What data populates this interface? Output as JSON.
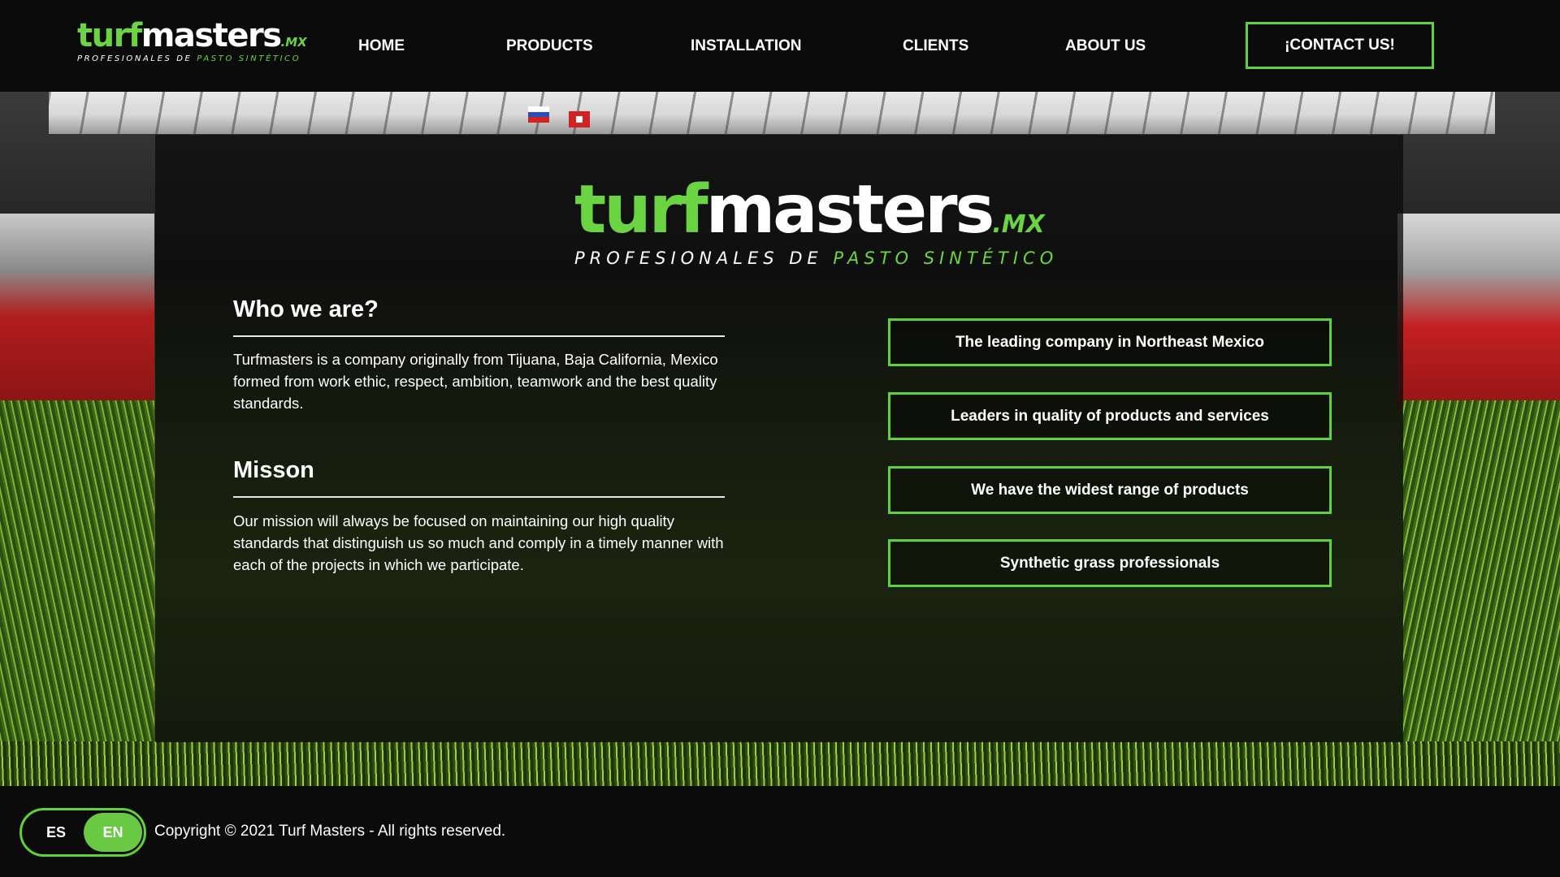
{
  "brand": {
    "logo_turf": "turf",
    "logo_masters": "masters",
    "logo_tld": ".MX",
    "tagline_white": "PROFESIONALES DE",
    "tagline_green": "PASTO SINTÉTICO",
    "accent_color": "#5fd13a"
  },
  "nav": {
    "items": [
      {
        "label": "HOME"
      },
      {
        "label": "PRODUCTS"
      },
      {
        "label": "INSTALLATION"
      },
      {
        "label": "CLIENTS"
      },
      {
        "label": "ABOUT US"
      }
    ],
    "cta_label": "¡CONTACT US!"
  },
  "about": {
    "who_title": "Who we are?",
    "who_text": "Turfmasters is a company originally from Tijuana, Baja California, Mexico formed from work ethic, respect, ambition, teamwork and the best quality standards.",
    "mission_title": "Misson",
    "mission_text": "Our mission will always be focused on maintaining our high quality standards that distinguish us so much and comply in a timely manner with each of the projects in which we participate."
  },
  "features": [
    {
      "label": "The leading company in Northeast Mexico"
    },
    {
      "label": "Leaders in quality of products and services"
    },
    {
      "label": "We have the widest range of products"
    },
    {
      "label": "Synthetic grass professionals"
    }
  ],
  "footer": {
    "lang_es": "ES",
    "lang_en": "EN",
    "active_language": "EN",
    "copyright": "Copyright © 2021 Turf Masters - All rights reserved."
  }
}
